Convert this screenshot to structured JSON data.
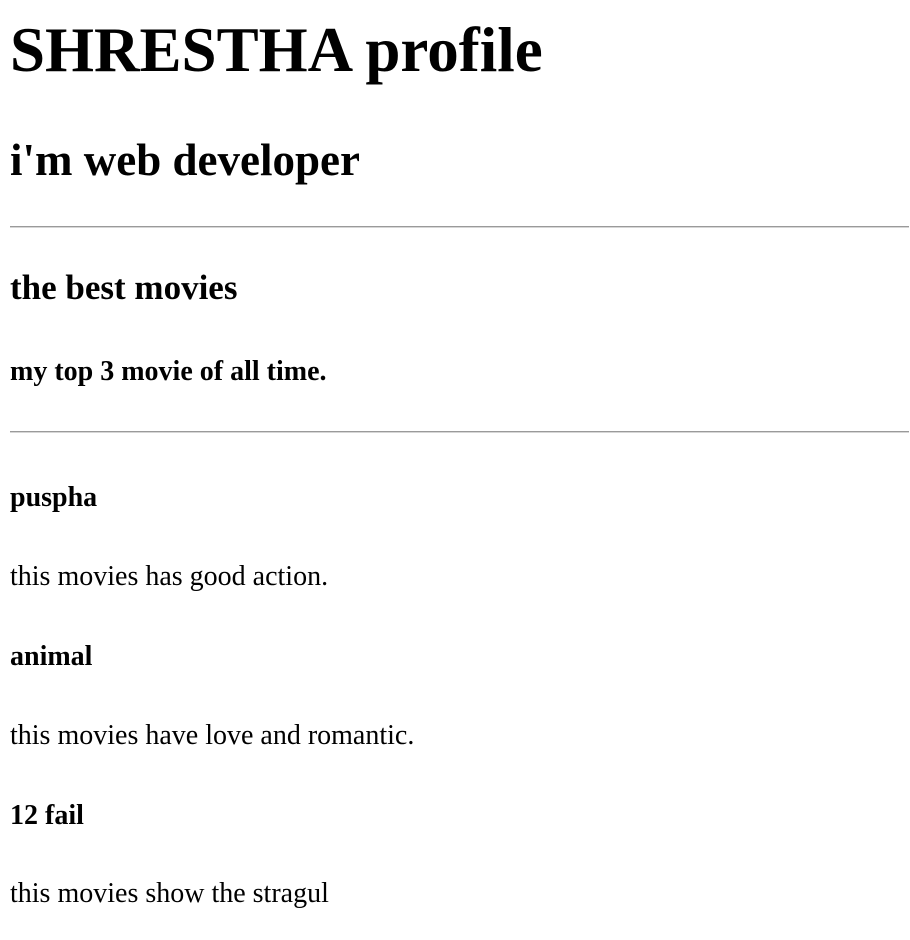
{
  "profile": {
    "title": "SHRESTHA profile",
    "role": "i'm web developer"
  },
  "section": {
    "title": "the best movies",
    "subtitle": "my top 3 movie of all time."
  },
  "movies": [
    {
      "title": "puspha",
      "description": "this movies has good action."
    },
    {
      "title": "animal",
      "description": "this movies have love and romantic."
    },
    {
      "title": "12 fail",
      "description": "this movies show the stragul"
    }
  ]
}
